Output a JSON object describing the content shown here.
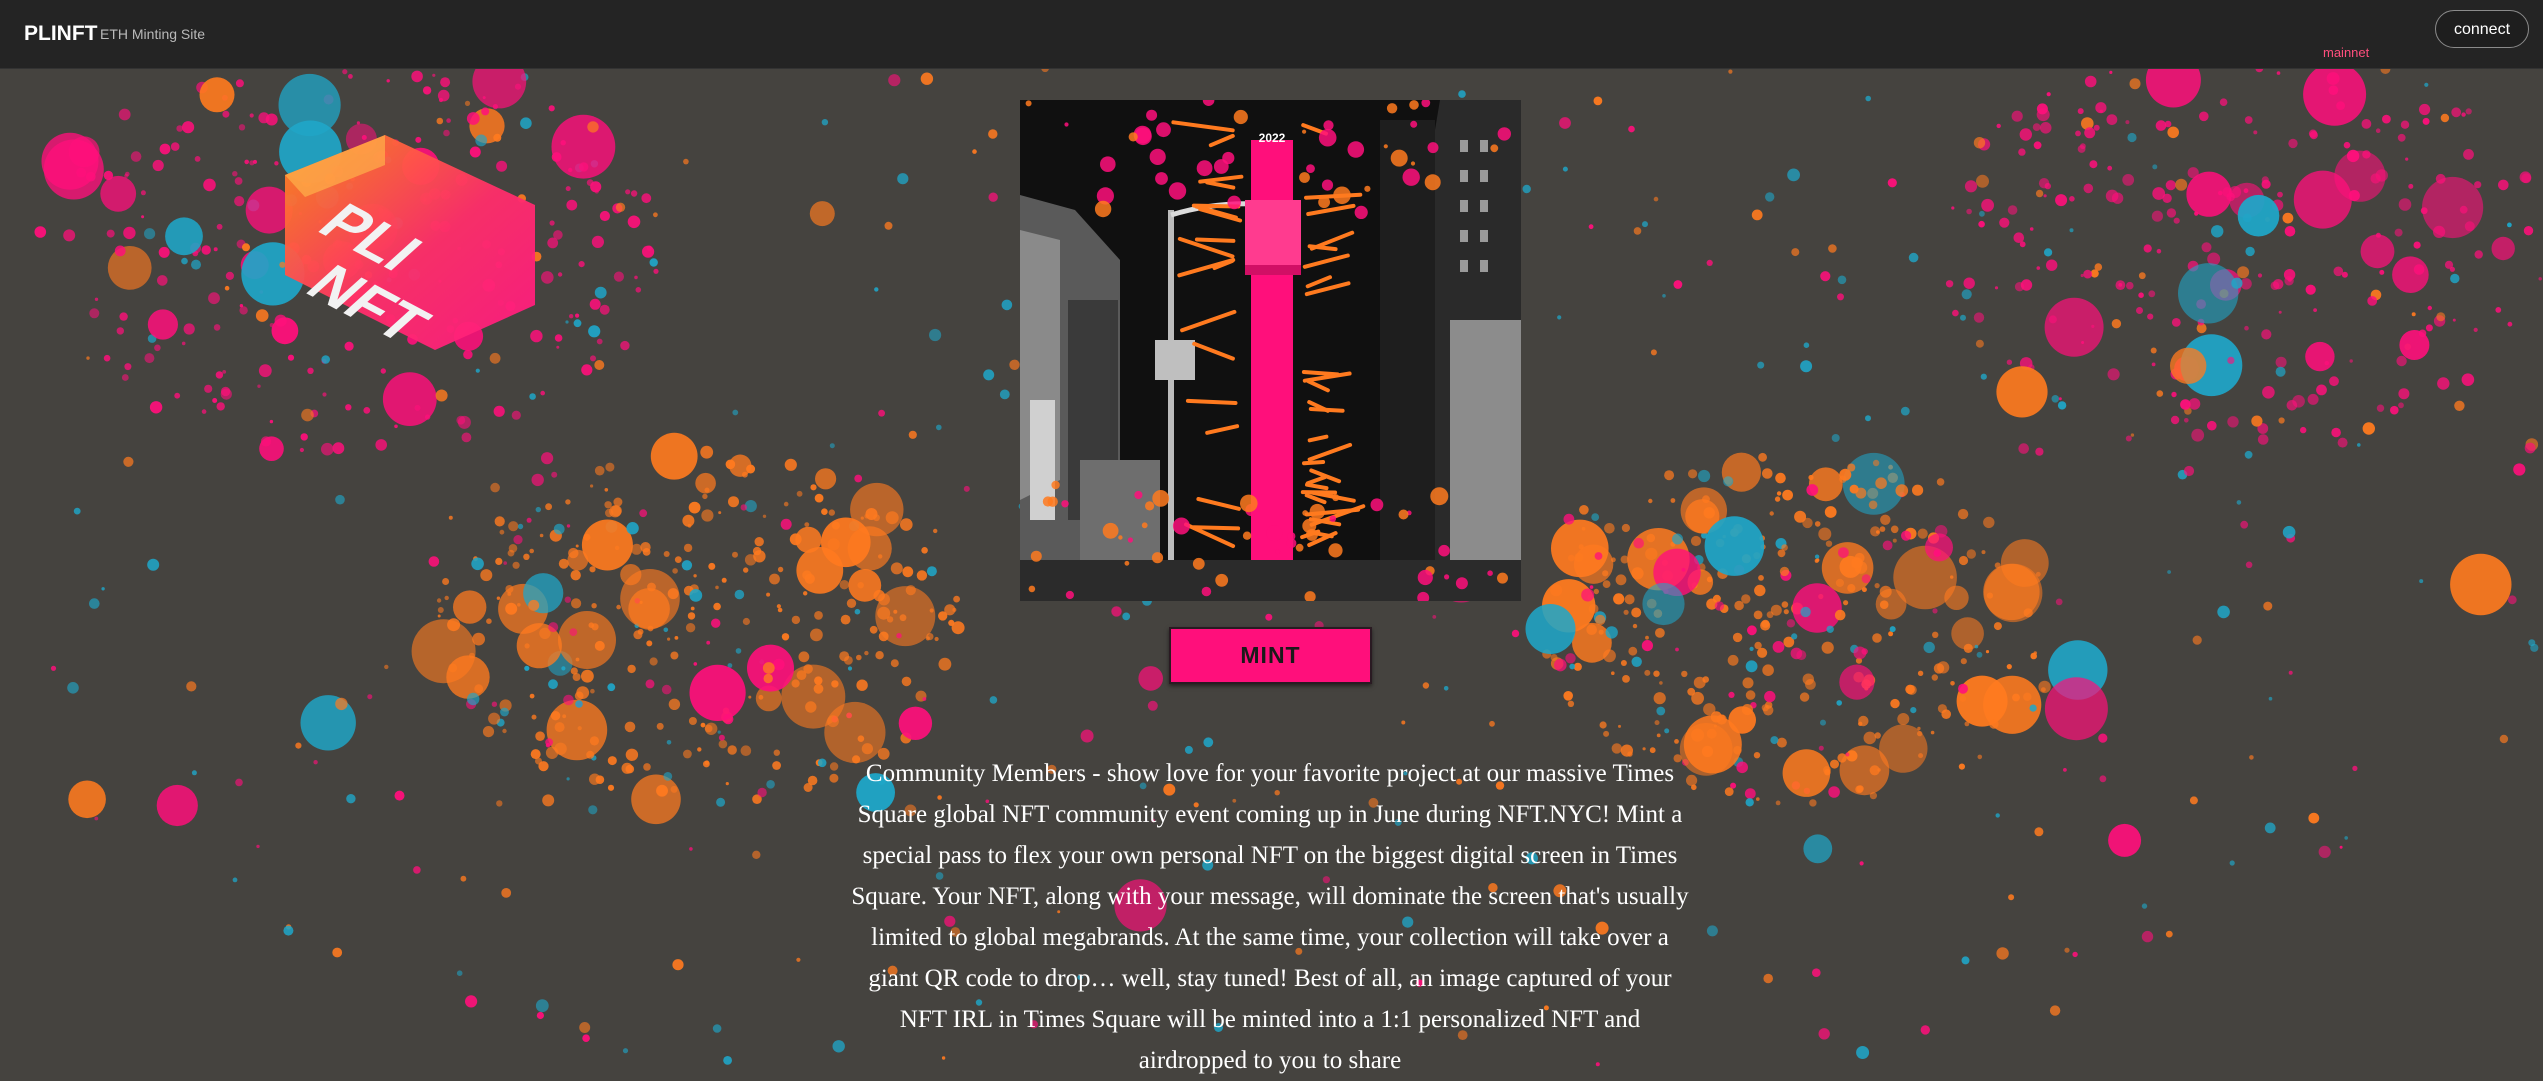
{
  "header": {
    "brand": "PLINFT",
    "tagline": "ETH Minting Site",
    "network": "mainnet",
    "connect_label": "connect"
  },
  "logo": {
    "line1": "PLI",
    "line2": "NFT"
  },
  "hero_image": {
    "year_label": "2022"
  },
  "mint_label": "MINT",
  "description": "Community Members - show love for your favorite project at our massive Times Square global NFT community event coming up in June during NFT.NYC! Mint a special pass to flex your own personal NFT on the biggest digital screen in Times Square. Your NFT, along with your message, will dominate the screen that's usually limited to global megabrands. At the same time, your collection will take over a giant QR code to drop… well, stay tuned! Best of all, an image captured of your NFT IRL in Times Square will be minted into a 1:1 personalized NFT and airdropped to you to share",
  "colors": {
    "background": "#45433f",
    "topbar": "#242424",
    "accent_pink": "#ff0f7b",
    "accent_orange": "#ff7a1f",
    "accent_cyan": "#1fa6c8",
    "network_text": "#ff4f7d"
  }
}
